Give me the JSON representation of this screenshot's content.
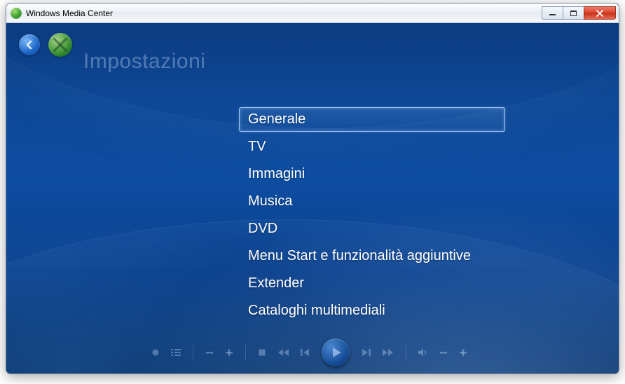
{
  "window": {
    "title": "Windows Media Center"
  },
  "page": {
    "heading": "Impostazioni"
  },
  "menu": {
    "items": [
      {
        "label": "Generale",
        "selected": true
      },
      {
        "label": "TV",
        "selected": false
      },
      {
        "label": "Immagini",
        "selected": false
      },
      {
        "label": "Musica",
        "selected": false
      },
      {
        "label": "DVD",
        "selected": false
      },
      {
        "label": "Menu Start e funzionalità aggiuntive",
        "selected": false
      },
      {
        "label": "Extender",
        "selected": false
      },
      {
        "label": "Cataloghi multimediali",
        "selected": false
      }
    ]
  },
  "icons": {
    "back": "back-arrow",
    "logo": "wmc-logo",
    "record": "record",
    "guide": "guide-list",
    "ch_down": "minus",
    "ch_up": "plus",
    "stop": "stop",
    "rewind": "rewind",
    "skip_back": "skip-back",
    "play": "play",
    "skip_fwd": "skip-forward",
    "ffwd": "fast-forward",
    "mute": "speaker",
    "vol_down": "minus",
    "vol_up": "plus"
  },
  "colors": {
    "accent": "#1d66c8",
    "bg_deep": "#063064",
    "bg_light": "#0e4896",
    "close": "#d9432b"
  }
}
